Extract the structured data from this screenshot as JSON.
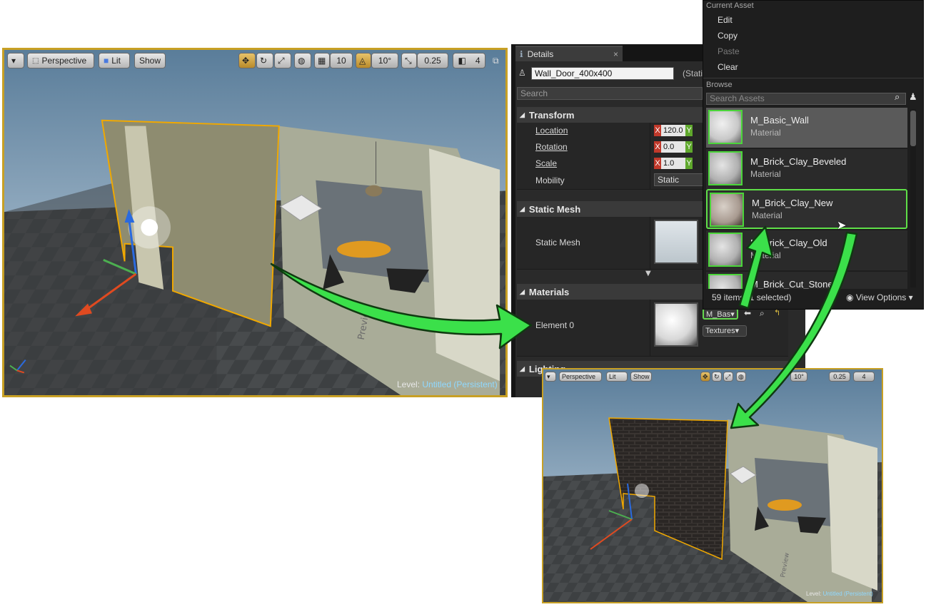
{
  "main_viewport": {
    "toolbar": {
      "perspective": "Perspective",
      "lit": "Lit",
      "show": "Show",
      "grid_snap": "10",
      "rotation_snap": "10°",
      "scale_snap": "0.25",
      "camera_speed": "4"
    },
    "level_label": "Level:",
    "level_value": "Untitled (Persistent)",
    "floor_text": "Preview"
  },
  "result_viewport": {
    "toolbar": {
      "perspective": "Perspective",
      "lit": "Lit",
      "show": "Show",
      "rotation_snap": "10°",
      "scale_snap": "0.25",
      "camera_speed": "4"
    },
    "level_label": "Level:",
    "level_value": "Untitled (Persistent)",
    "floor_text": "Preview"
  },
  "details": {
    "tab_label": "Details",
    "actor_name": "Wall_Door_400x400",
    "actor_type_partial": "(Stati",
    "search_placeholder": "Search",
    "transform": {
      "header": "Transform",
      "location_label": "Location",
      "location_x": "120.0",
      "rotation_label": "Rotation",
      "rotation_x": "0.0",
      "scale_label": "Scale",
      "scale_x": "1.0",
      "mobility_label": "Mobility",
      "mobility_value": "Static"
    },
    "static_mesh": {
      "header": "Static Mesh",
      "label": "Static Mesh"
    },
    "materials": {
      "header": "Materials",
      "element_label": "Element 0",
      "combo_value": "M_Bas",
      "textures_label": "Textures"
    },
    "lighting_header": "Lighting"
  },
  "dropdown": {
    "current_asset_label": "Current Asset",
    "items": [
      {
        "label": "Edit",
        "enabled": true
      },
      {
        "label": "Copy",
        "enabled": true
      },
      {
        "label": "Paste",
        "enabled": false
      },
      {
        "label": "Clear",
        "enabled": true
      }
    ],
    "browse_label": "Browse",
    "search_placeholder": "Search Assets",
    "assets": [
      {
        "name": "M_Basic_Wall",
        "type": "Material",
        "state": "selected"
      },
      {
        "name": "M_Brick_Clay_Beveled",
        "type": "Material",
        "state": "normal"
      },
      {
        "name": "M_Brick_Clay_New",
        "type": "Material",
        "state": "hover"
      },
      {
        "name": "M_Brick_Clay_Old",
        "type": "Material",
        "state": "normal"
      },
      {
        "name": "M_Brick_Cut_Stone",
        "type": "",
        "state": "normal"
      }
    ],
    "footer_count": "59 items (1 selected)",
    "view_options": "View Options"
  },
  "colors": {
    "selection_outline": "#c8a024",
    "arrow_green": "#3be04a",
    "panel_bg": "#2a2a2a"
  }
}
